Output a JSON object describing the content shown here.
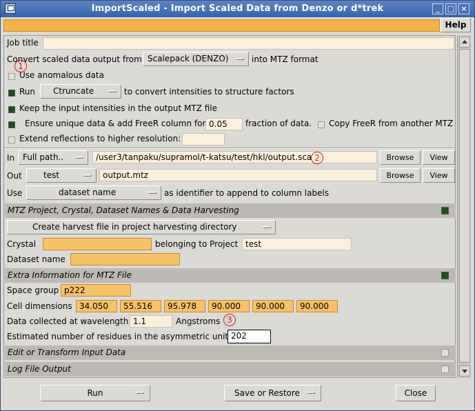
{
  "window": {
    "title": "ImportScaled - Import Scaled Data from Denzo or d*trek",
    "buttons": {
      "minimize": "_",
      "maximize": "□",
      "close": "×"
    }
  },
  "toolbar": {
    "help_label": "Help"
  },
  "main": {
    "job_title_label": "Job title",
    "job_title_value": "",
    "convert_prefix": "Convert scaled data output from",
    "convert_format": "Scalepack (DENZO)",
    "convert_suffix": "into MTZ format",
    "anomalous_label": "Use anomalous data",
    "run_label": "Run",
    "run_program": "Ctruncate",
    "run_suffix": "to convert intensities to structure factors",
    "keep_intensities_label": "Keep the input intensities in the output MTZ file",
    "unique_label": "Ensure unique data & add FreeR column for",
    "freer_fraction": "0.05",
    "fraction_label": "fraction of data.",
    "copy_freer_label": "Copy FreeR from another MTZ",
    "extend_label": "Extend reflections to higher resolution:",
    "extend_value": "",
    "in_label": "In",
    "in_mode": "Full path..",
    "in_path": "/user3/tanpaku/supramol/t-katsu/test/hkl/output.sca",
    "browse_label": "Browse",
    "view_label": "View",
    "out_label": "Out",
    "out_mode": "test",
    "out_file": "output.mtz",
    "use_label": "Use",
    "use_option": "dataset name",
    "use_suffix": "as identifier to append to column labels"
  },
  "annotations": {
    "one": "1",
    "two": "2",
    "three": "3"
  },
  "harvest": {
    "header": "MTZ Project, Crystal, Dataset Names & Data Harvesting",
    "harvest_option": "Create harvest file in project harvesting directory",
    "crystal_label": "Crystal",
    "crystal_value": "",
    "belonging_label": "belonging to Project",
    "project_value": "test",
    "dataset_label": "Dataset name",
    "dataset_value": ""
  },
  "extra": {
    "header": "Extra Information for MTZ File",
    "space_group_label": "Space group",
    "space_group_value": "p222",
    "cell_label": "Cell dimensions",
    "cell": [
      "34.050",
      "55.516",
      "95.978",
      "90.000",
      "90.000",
      "90.000"
    ],
    "wavelength_label": "Data collected at wavelength",
    "wavelength_value": "1.1",
    "angstroms_label": "Angstroms",
    "residues_label": "Estimated number of residues in the asymmetric unit",
    "residues_value": "202"
  },
  "sections": {
    "edit_transform": "Edit or Transform Input Data",
    "log_file": "Log File Output"
  },
  "bottom": {
    "run_label": "Run",
    "save_restore_label": "Save or Restore",
    "close_label": "Close"
  },
  "colors": {
    "title_bar": "#3663ad",
    "required_field": "#f6c26a",
    "field": "#fbf0dc",
    "section_header": "#bdbab3",
    "checkbox_on": "#1b4e1e",
    "annotation": "#cc2222"
  }
}
